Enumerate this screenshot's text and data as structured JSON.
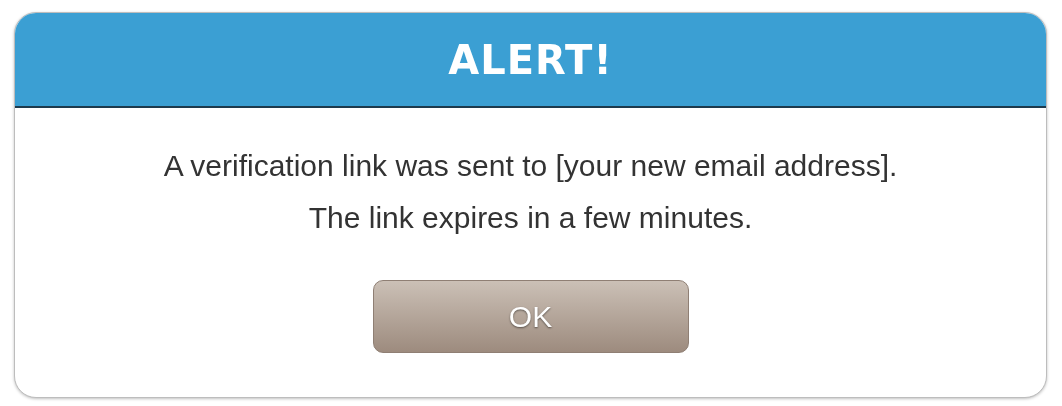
{
  "dialog": {
    "title": "ALERT!",
    "message_lines": [
      "A verification link was sent to [your new email address].",
      "The link expires in a few minutes."
    ],
    "buttons": [
      {
        "label": "OK"
      }
    ]
  }
}
